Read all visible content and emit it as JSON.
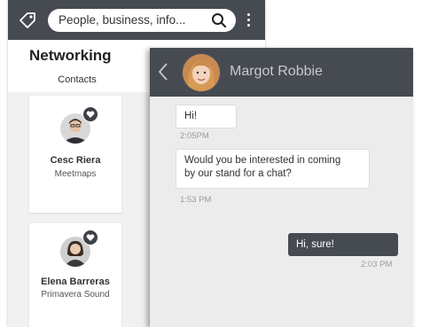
{
  "search": {
    "text": "People, business, info..."
  },
  "section": {
    "title": "Networking",
    "tab": "Contacts"
  },
  "contacts": [
    {
      "name": "Cesc Riera",
      "company": "Meetmaps"
    },
    {
      "name": "Elena Barreras",
      "company": "Primavera Sound"
    }
  ],
  "chat": {
    "contact_name": "Margot Robbie",
    "messages": [
      {
        "direction": "in",
        "text": "Hi!",
        "time": "2:05PM"
      },
      {
        "direction": "in",
        "text_line1": "Would you be interested in coming",
        "text_line2": "by our stand for a chat?",
        "time": "1:53 PM"
      },
      {
        "direction": "out",
        "text": "Hi, sure!",
        "time": "2:03 PM"
      }
    ]
  },
  "icons": [
    "tag-icon",
    "search-icon",
    "menu-dots-icon",
    "heart-icon",
    "back-chevron-icon"
  ],
  "colors": {
    "header": "#464a51",
    "outgoing_bubble": "#464a51",
    "chat_background": "#ececec"
  }
}
